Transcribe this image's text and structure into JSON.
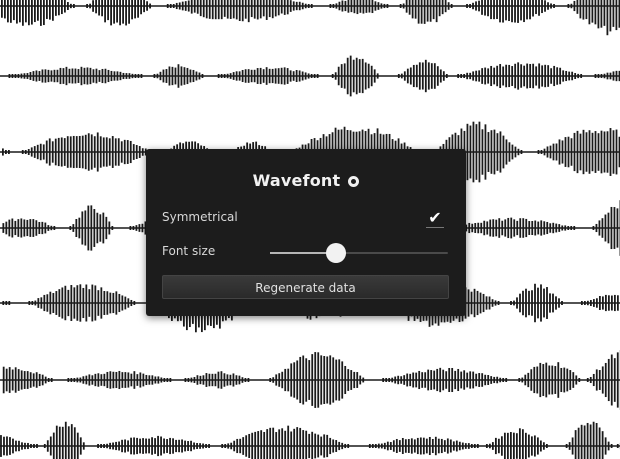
{
  "panel": {
    "title": "Wavefont",
    "symmetrical_label": "Symmetrical",
    "symmetrical_checked": true,
    "font_size_label": "Font size",
    "font_size_fraction": 0.37,
    "regenerate_label": "Regenerate data"
  },
  "icons": {
    "title_icon": "github-icon",
    "checkbox_icon": "checkmark-icon"
  },
  "colors": {
    "panel_bg": "#1c1c1c",
    "wave": "#1a1a1a",
    "page_bg": "#ffffff"
  }
}
